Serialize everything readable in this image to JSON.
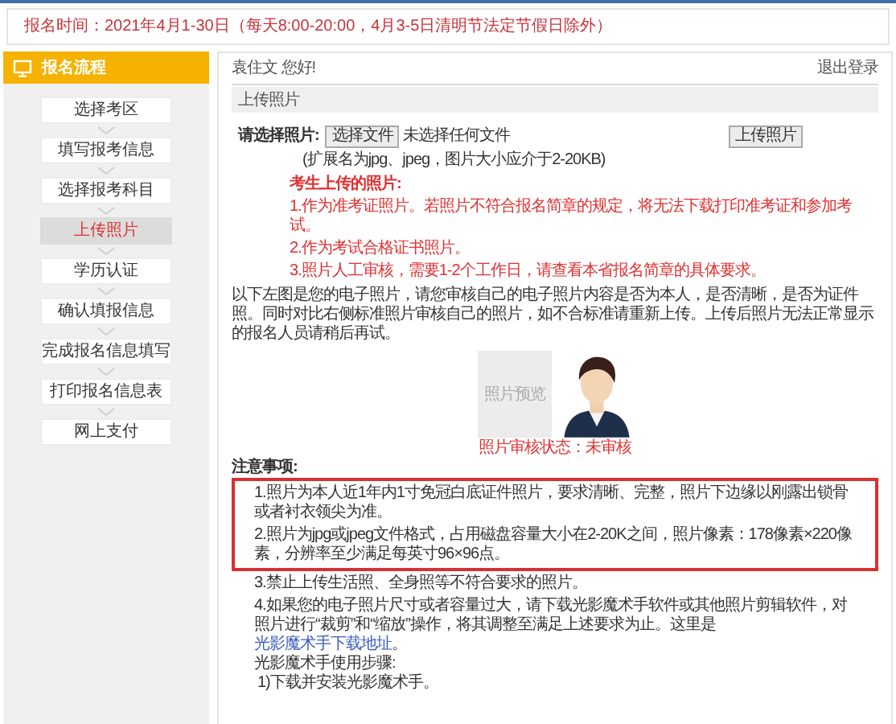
{
  "notice": "报名时间：2021年4月1-30日（每天8:00-20:00，4月3-5日清明节法定节假日除外）",
  "sidebar": {
    "title": "报名流程",
    "steps": [
      {
        "label": "选择考区",
        "selected": false
      },
      {
        "label": "填写报考信息",
        "selected": false
      },
      {
        "label": "选择报考科目",
        "selected": false
      },
      {
        "label": "上传照片",
        "selected": true
      },
      {
        "label": "学历认证",
        "selected": false
      },
      {
        "label": "确认填报信息",
        "selected": false
      },
      {
        "label": "完成报名信息填写",
        "selected": false
      },
      {
        "label": "打印报名信息表",
        "selected": false
      },
      {
        "label": "网上支付",
        "selected": false
      }
    ]
  },
  "greeting": "袁住文 您好!",
  "logout": "退出登录",
  "section_title": "上传照片",
  "upload": {
    "label": "请选择照片:",
    "choose_button": "选择文件",
    "file_status": "未选择任何文件",
    "upload_button": "上传照片",
    "hint": "(扩展名为jpg、jpeg，图片大小应介于2-20KB)"
  },
  "requirements": {
    "title": "考生上传的照片:",
    "items": [
      "1.作为准考证照片。若照片不符合报名简章的规定，将无法下载打印准考证和参加考试。",
      "2.作为考试合格证书照片。",
      "3.照片人工审核，需要1-2个工作日，请查看本省报名简章的具体要求。"
    ]
  },
  "instructions": "以下左图是您的电子照片，请您审核自己的电子照片内容是否为本人，是否清晰，是否为证件照。同时对比右侧标准照片审核自己的照片，如不合标准请重新上传。上传后照片无法正常显示的报名人员请稍后再试。",
  "preview": {
    "placeholder": "照片预览",
    "status": "照片审核状态：未审核"
  },
  "notes": {
    "title": "注意事项:",
    "highlighted": [
      "1.照片为本人近1年内1寸免冠白底证件照片，要求清晰、完整，照片下边缘以刚露出锁骨或者衬衣领尖为准。",
      "2.照片为jpg或jpeg文件格式，占用磁盘容量大小在2-20K之间，照片像素：178像素×220像素，分辨率至少满足每英寸96×96点。"
    ],
    "item3": "3.禁止上传生活照、全身照等不符合要求的照片。",
    "item4": {
      "text": "4.如果您的电子照片尺寸或者容量过大，请下载光影魔术手软件或其他照片剪辑软件，对照片进行“裁剪”和“缩放”操作，将其调整至满足上述要求为止。这里是",
      "link": "光影魔术手下载地址",
      "after": "。"
    },
    "steps_title": "光影魔术手使用步骤:",
    "steps": [
      "1)下载并安装光影魔术手。"
    ]
  }
}
